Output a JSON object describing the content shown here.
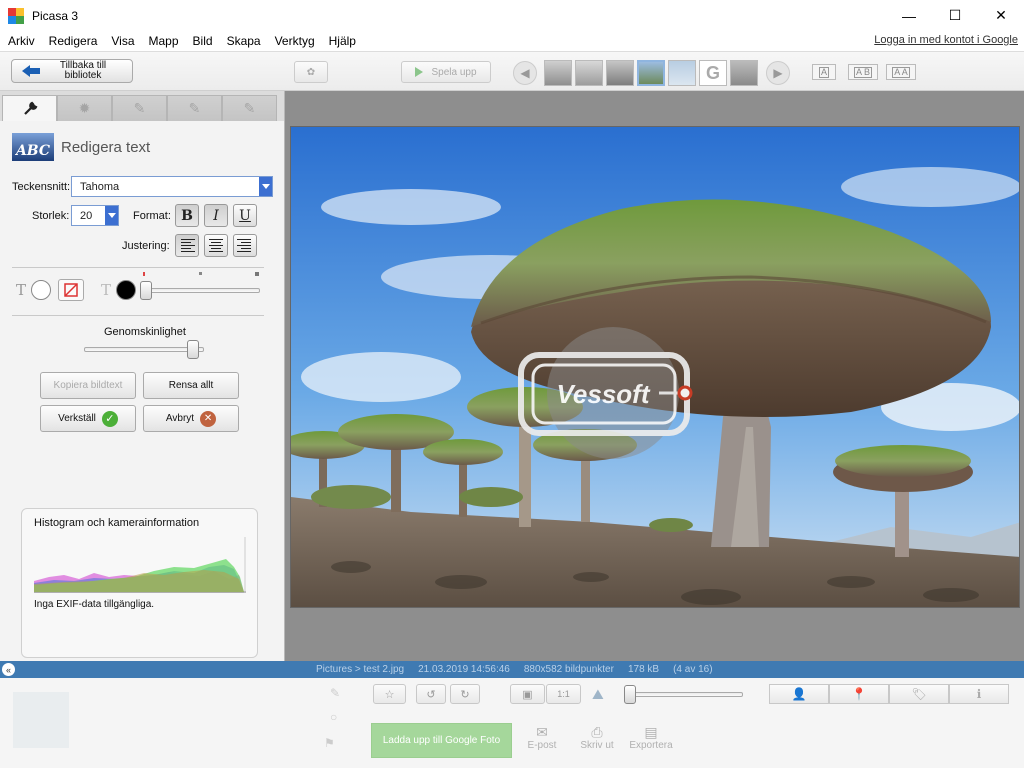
{
  "window": {
    "title": "Picasa 3",
    "minimize": "—",
    "maximize": "☐",
    "close": "✕"
  },
  "menu": {
    "items": [
      "Arkiv",
      "Redigera",
      "Visa",
      "Mapp",
      "Bild",
      "Skapa",
      "Verktyg",
      "Hjälp"
    ],
    "login": "Logga in med kontot i Google"
  },
  "toolbar": {
    "back_line1": "Tillbaka till",
    "back_line2": "bibliotek",
    "play": "Spela upp",
    "text_sizes": [
      "A",
      "A B",
      "A A"
    ]
  },
  "panel": {
    "heading": "Redigera text",
    "abc": "ABC",
    "font_label": "Teckensnitt:",
    "font_value": "Tahoma",
    "size_label": "Storlek:",
    "size_value": "20",
    "format_label": "Format:",
    "bold": "B",
    "italic": "I",
    "underline": "U",
    "align_label": "Justering:",
    "opacity_label": "Genomskinlighet",
    "copy_text": "Kopiera bildtext",
    "clear_all": "Rensa allt",
    "apply": "Verkställ",
    "cancel": "Avbryt",
    "opacity_level": 0.95,
    "outline_level": 0.0
  },
  "histogram": {
    "title": "Histogram och kamerainformation",
    "exif": "Inga EXIF-data tillgängliga."
  },
  "photo": {
    "watermark": "Vessoft"
  },
  "status": {
    "collapse": "«",
    "path": "Pictures > test 2.jpg",
    "datetime": "21.03.2019 14:56:46",
    "dimensions": "880x582 bildpunkter",
    "size": "178 kB",
    "position": "(4 av 16)"
  },
  "tray": {
    "upload": "Ladda upp till Google Foto",
    "email": "E-post",
    "print": "Skriv ut",
    "export": "Exportera"
  },
  "colors": {
    "status_bar": "#3f7ab2",
    "photo_bg": "#8e8e8e",
    "accent_blue": "#3c6fd1",
    "apply_green": "#4caf38",
    "cancel_red": "#c0633f"
  }
}
